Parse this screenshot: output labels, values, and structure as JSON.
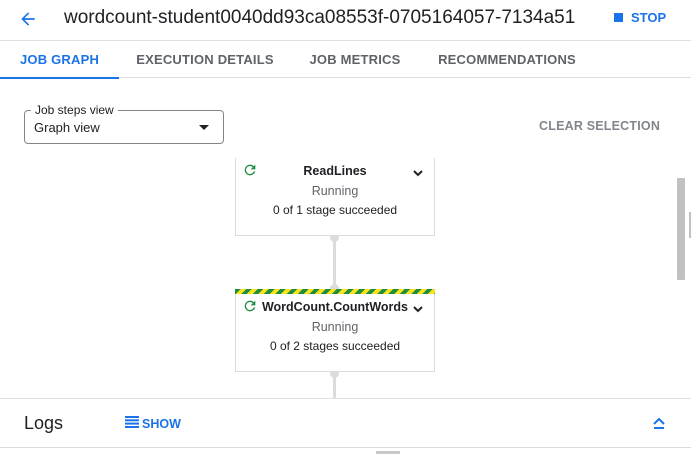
{
  "header": {
    "job_title": "wordcount-student0040dd93ca08553f-0705164057-7134a51",
    "stop_label": "STOP"
  },
  "tabs": [
    {
      "label": "JOB GRAPH",
      "active": true
    },
    {
      "label": "EXECUTION DETAILS",
      "active": false
    },
    {
      "label": "JOB METRICS",
      "active": false
    },
    {
      "label": "RECOMMENDATIONS",
      "active": false
    }
  ],
  "steps_view": {
    "legend": "Job steps view",
    "value": "Graph view"
  },
  "clear_selection_label": "CLEAR SELECTION",
  "graph": {
    "nodes": [
      {
        "name": "ReadLines",
        "status": "Running",
        "stages": "0 of 1 stage succeeded",
        "icon": "running-refresh-icon"
      },
      {
        "name": "WordCount.CountWords",
        "status": "Running",
        "stages": "0 of 2 stages succeeded",
        "icon": "running-refresh-icon"
      }
    ]
  },
  "logs": {
    "title": "Logs",
    "show_label": "SHOW"
  },
  "colors": {
    "accent": "#1a73e8",
    "running_green": "#1e8e3e",
    "stripe_yellow": "#f9e21e"
  }
}
